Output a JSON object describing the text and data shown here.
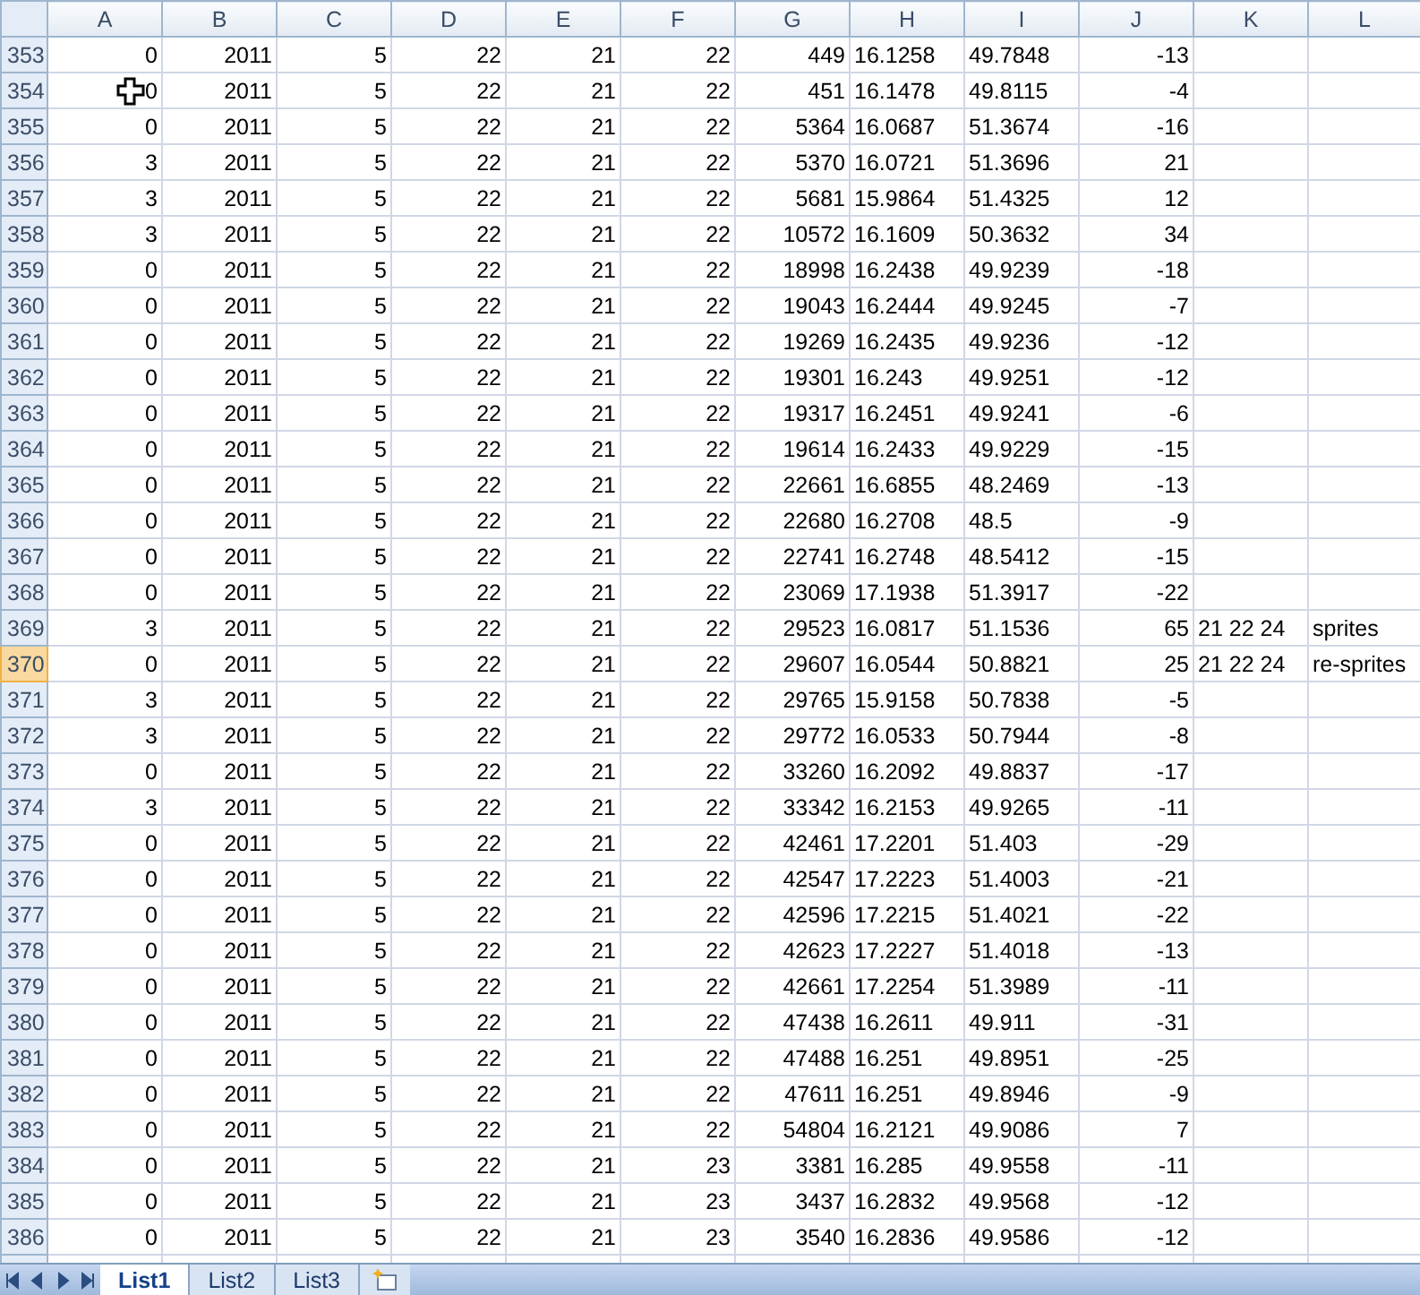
{
  "columns": [
    {
      "label": "A",
      "kind": "number"
    },
    {
      "label": "B",
      "kind": "number"
    },
    {
      "label": "C",
      "kind": "number"
    },
    {
      "label": "D",
      "kind": "number"
    },
    {
      "label": "E",
      "kind": "number"
    },
    {
      "label": "F",
      "kind": "number"
    },
    {
      "label": "G",
      "kind": "number"
    },
    {
      "label": "H",
      "kind": "text"
    },
    {
      "label": "I",
      "kind": "text"
    },
    {
      "label": "J",
      "kind": "number"
    },
    {
      "label": "K",
      "kind": "text"
    },
    {
      "label": "L",
      "kind": "text"
    }
  ],
  "rows": [
    {
      "header": "353",
      "selected": false,
      "cells": [
        "0",
        "2011",
        "5",
        "22",
        "21",
        "22",
        "449",
        "16.1258",
        "49.7848",
        "-13"
      ]
    },
    {
      "header": "354",
      "selected": false,
      "cells": [
        "0",
        "2011",
        "5",
        "22",
        "21",
        "22",
        "451",
        "16.1478",
        "49.8115",
        "-4"
      ]
    },
    {
      "header": "355",
      "selected": false,
      "cells": [
        "0",
        "2011",
        "5",
        "22",
        "21",
        "22",
        "5364",
        "16.0687",
        "51.3674",
        "-16"
      ]
    },
    {
      "header": "356",
      "selected": false,
      "cells": [
        "3",
        "2011",
        "5",
        "22",
        "21",
        "22",
        "5370",
        "16.0721",
        "51.3696",
        "21"
      ]
    },
    {
      "header": "357",
      "selected": false,
      "cells": [
        "3",
        "2011",
        "5",
        "22",
        "21",
        "22",
        "5681",
        "15.9864",
        "51.4325",
        "12"
      ]
    },
    {
      "header": "358",
      "selected": false,
      "cells": [
        "3",
        "2011",
        "5",
        "22",
        "21",
        "22",
        "10572",
        "16.1609",
        "50.3632",
        "34"
      ]
    },
    {
      "header": "359",
      "selected": false,
      "cells": [
        "0",
        "2011",
        "5",
        "22",
        "21",
        "22",
        "18998",
        "16.2438",
        "49.9239",
        "-18"
      ]
    },
    {
      "header": "360",
      "selected": false,
      "cells": [
        "0",
        "2011",
        "5",
        "22",
        "21",
        "22",
        "19043",
        "16.2444",
        "49.9245",
        "-7"
      ]
    },
    {
      "header": "361",
      "selected": false,
      "cells": [
        "0",
        "2011",
        "5",
        "22",
        "21",
        "22",
        "19269",
        "16.2435",
        "49.9236",
        "-12"
      ]
    },
    {
      "header": "362",
      "selected": false,
      "cells": [
        "0",
        "2011",
        "5",
        "22",
        "21",
        "22",
        "19301",
        "16.243",
        "49.9251",
        "-12"
      ]
    },
    {
      "header": "363",
      "selected": false,
      "cells": [
        "0",
        "2011",
        "5",
        "22",
        "21",
        "22",
        "19317",
        "16.2451",
        "49.9241",
        "-6"
      ]
    },
    {
      "header": "364",
      "selected": false,
      "cells": [
        "0",
        "2011",
        "5",
        "22",
        "21",
        "22",
        "19614",
        "16.2433",
        "49.9229",
        "-15"
      ]
    },
    {
      "header": "365",
      "selected": false,
      "cells": [
        "0",
        "2011",
        "5",
        "22",
        "21",
        "22",
        "22661",
        "16.6855",
        "48.2469",
        "-13"
      ]
    },
    {
      "header": "366",
      "selected": false,
      "cells": [
        "0",
        "2011",
        "5",
        "22",
        "21",
        "22",
        "22680",
        "16.2708",
        "48.5",
        "-9"
      ]
    },
    {
      "header": "367",
      "selected": false,
      "cells": [
        "0",
        "2011",
        "5",
        "22",
        "21",
        "22",
        "22741",
        "16.2748",
        "48.5412",
        "-15"
      ]
    },
    {
      "header": "368",
      "selected": false,
      "cells": [
        "0",
        "2011",
        "5",
        "22",
        "21",
        "22",
        "23069",
        "17.1938",
        "51.3917",
        "-22"
      ]
    },
    {
      "header": "369",
      "selected": false,
      "cells": [
        "3",
        "2011",
        "5",
        "22",
        "21",
        "22",
        "29523",
        "16.0817",
        "51.1536",
        "65",
        "21 22 24",
        "sprites"
      ]
    },
    {
      "header": "370",
      "selected": true,
      "cells": [
        "0",
        "2011",
        "5",
        "22",
        "21",
        "22",
        "29607",
        "16.0544",
        "50.8821",
        "25",
        "21 22 24",
        "re-sprites"
      ]
    },
    {
      "header": "371",
      "selected": false,
      "cells": [
        "3",
        "2011",
        "5",
        "22",
        "21",
        "22",
        "29765",
        "15.9158",
        "50.7838",
        "-5"
      ]
    },
    {
      "header": "372",
      "selected": false,
      "cells": [
        "3",
        "2011",
        "5",
        "22",
        "21",
        "22",
        "29772",
        "16.0533",
        "50.7944",
        "-8"
      ]
    },
    {
      "header": "373",
      "selected": false,
      "cells": [
        "0",
        "2011",
        "5",
        "22",
        "21",
        "22",
        "33260",
        "16.2092",
        "49.8837",
        "-17"
      ]
    },
    {
      "header": "374",
      "selected": false,
      "cells": [
        "3",
        "2011",
        "5",
        "22",
        "21",
        "22",
        "33342",
        "16.2153",
        "49.9265",
        "-11"
      ]
    },
    {
      "header": "375",
      "selected": false,
      "cells": [
        "0",
        "2011",
        "5",
        "22",
        "21",
        "22",
        "42461",
        "17.2201",
        "51.403",
        "-29"
      ]
    },
    {
      "header": "376",
      "selected": false,
      "cells": [
        "0",
        "2011",
        "5",
        "22",
        "21",
        "22",
        "42547",
        "17.2223",
        "51.4003",
        "-21"
      ]
    },
    {
      "header": "377",
      "selected": false,
      "cells": [
        "0",
        "2011",
        "5",
        "22",
        "21",
        "22",
        "42596",
        "17.2215",
        "51.4021",
        "-22"
      ]
    },
    {
      "header": "378",
      "selected": false,
      "cells": [
        "0",
        "2011",
        "5",
        "22",
        "21",
        "22",
        "42623",
        "17.2227",
        "51.4018",
        "-13"
      ]
    },
    {
      "header": "379",
      "selected": false,
      "cells": [
        "0",
        "2011",
        "5",
        "22",
        "21",
        "22",
        "42661",
        "17.2254",
        "51.3989",
        "-11"
      ]
    },
    {
      "header": "380",
      "selected": false,
      "cells": [
        "0",
        "2011",
        "5",
        "22",
        "21",
        "22",
        "47438",
        "16.2611",
        "49.911",
        "-31"
      ]
    },
    {
      "header": "381",
      "selected": false,
      "cells": [
        "0",
        "2011",
        "5",
        "22",
        "21",
        "22",
        "47488",
        "16.251",
        "49.8951",
        "-25"
      ]
    },
    {
      "header": "382",
      "selected": false,
      "cells": [
        "0",
        "2011",
        "5",
        "22",
        "21",
        "22",
        "47611",
        "16.251",
        "49.8946",
        "-9"
      ]
    },
    {
      "header": "383",
      "selected": false,
      "cells": [
        "0",
        "2011",
        "5",
        "22",
        "21",
        "22",
        "54804",
        "16.2121",
        "49.9086",
        "7"
      ]
    },
    {
      "header": "384",
      "selected": false,
      "cells": [
        "0",
        "2011",
        "5",
        "22",
        "21",
        "23",
        "3381",
        "16.285",
        "49.9558",
        "-11"
      ]
    },
    {
      "header": "385",
      "selected": false,
      "cells": [
        "0",
        "2011",
        "5",
        "22",
        "21",
        "23",
        "3437",
        "16.2832",
        "49.9568",
        "-12"
      ]
    },
    {
      "header": "386",
      "selected": false,
      "cells": [
        "0",
        "2011",
        "5",
        "22",
        "21",
        "23",
        "3540",
        "16.2836",
        "49.9586",
        "-12"
      ]
    }
  ],
  "sheet_tabs": [
    {
      "label": "List1",
      "selected": true
    },
    {
      "label": "List2",
      "selected": false
    },
    {
      "label": "List3",
      "selected": false
    }
  ]
}
